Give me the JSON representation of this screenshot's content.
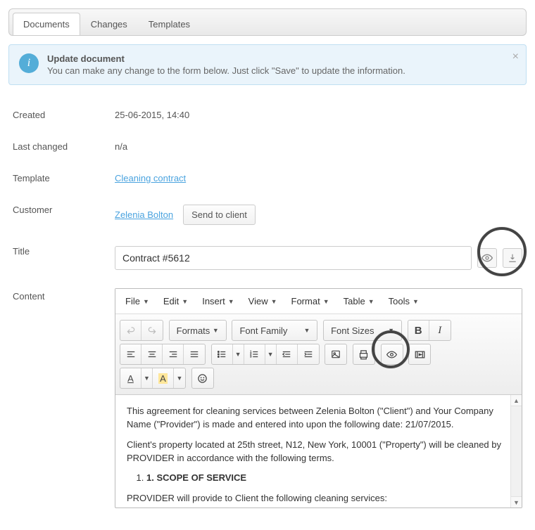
{
  "tabs": [
    "Documents",
    "Changes",
    "Templates"
  ],
  "active_tab": 0,
  "alert": {
    "title": "Update document",
    "message": "You can make any change to the form below. Just click \"Save\" to update the information."
  },
  "fields": {
    "created_label": "Created",
    "created_value": "25-06-2015, 14:40",
    "last_changed_label": "Last changed",
    "last_changed_value": "n/a",
    "template_label": "Template",
    "template_link": "Cleaning contract",
    "customer_label": "Customer",
    "customer_link": "Zelenia Bolton",
    "send_button": "Send to client",
    "title_label": "Title",
    "title_value": "Contract #5612",
    "content_label": "Content"
  },
  "editor": {
    "menus": [
      "File",
      "Edit",
      "Insert",
      "View",
      "Format",
      "Table",
      "Tools"
    ],
    "formats": "Formats",
    "font_family": "Font Family",
    "font_sizes": "Font Sizes",
    "body_p1": "This agreement for cleaning services between Zelenia Bolton (\"Client\") and Your Company Name (\"Provider\") is made and entered into upon the following date: 21/07/2015.",
    "body_p2": "Client's property located at 25th street, N12, New York, 10001 (\"Property\") will be cleaned by PROVIDER in accordance with the following terms.",
    "body_li1": "1. SCOPE OF SERVICE",
    "body_p3": "PROVIDER will provide to Client the following cleaning services:"
  }
}
